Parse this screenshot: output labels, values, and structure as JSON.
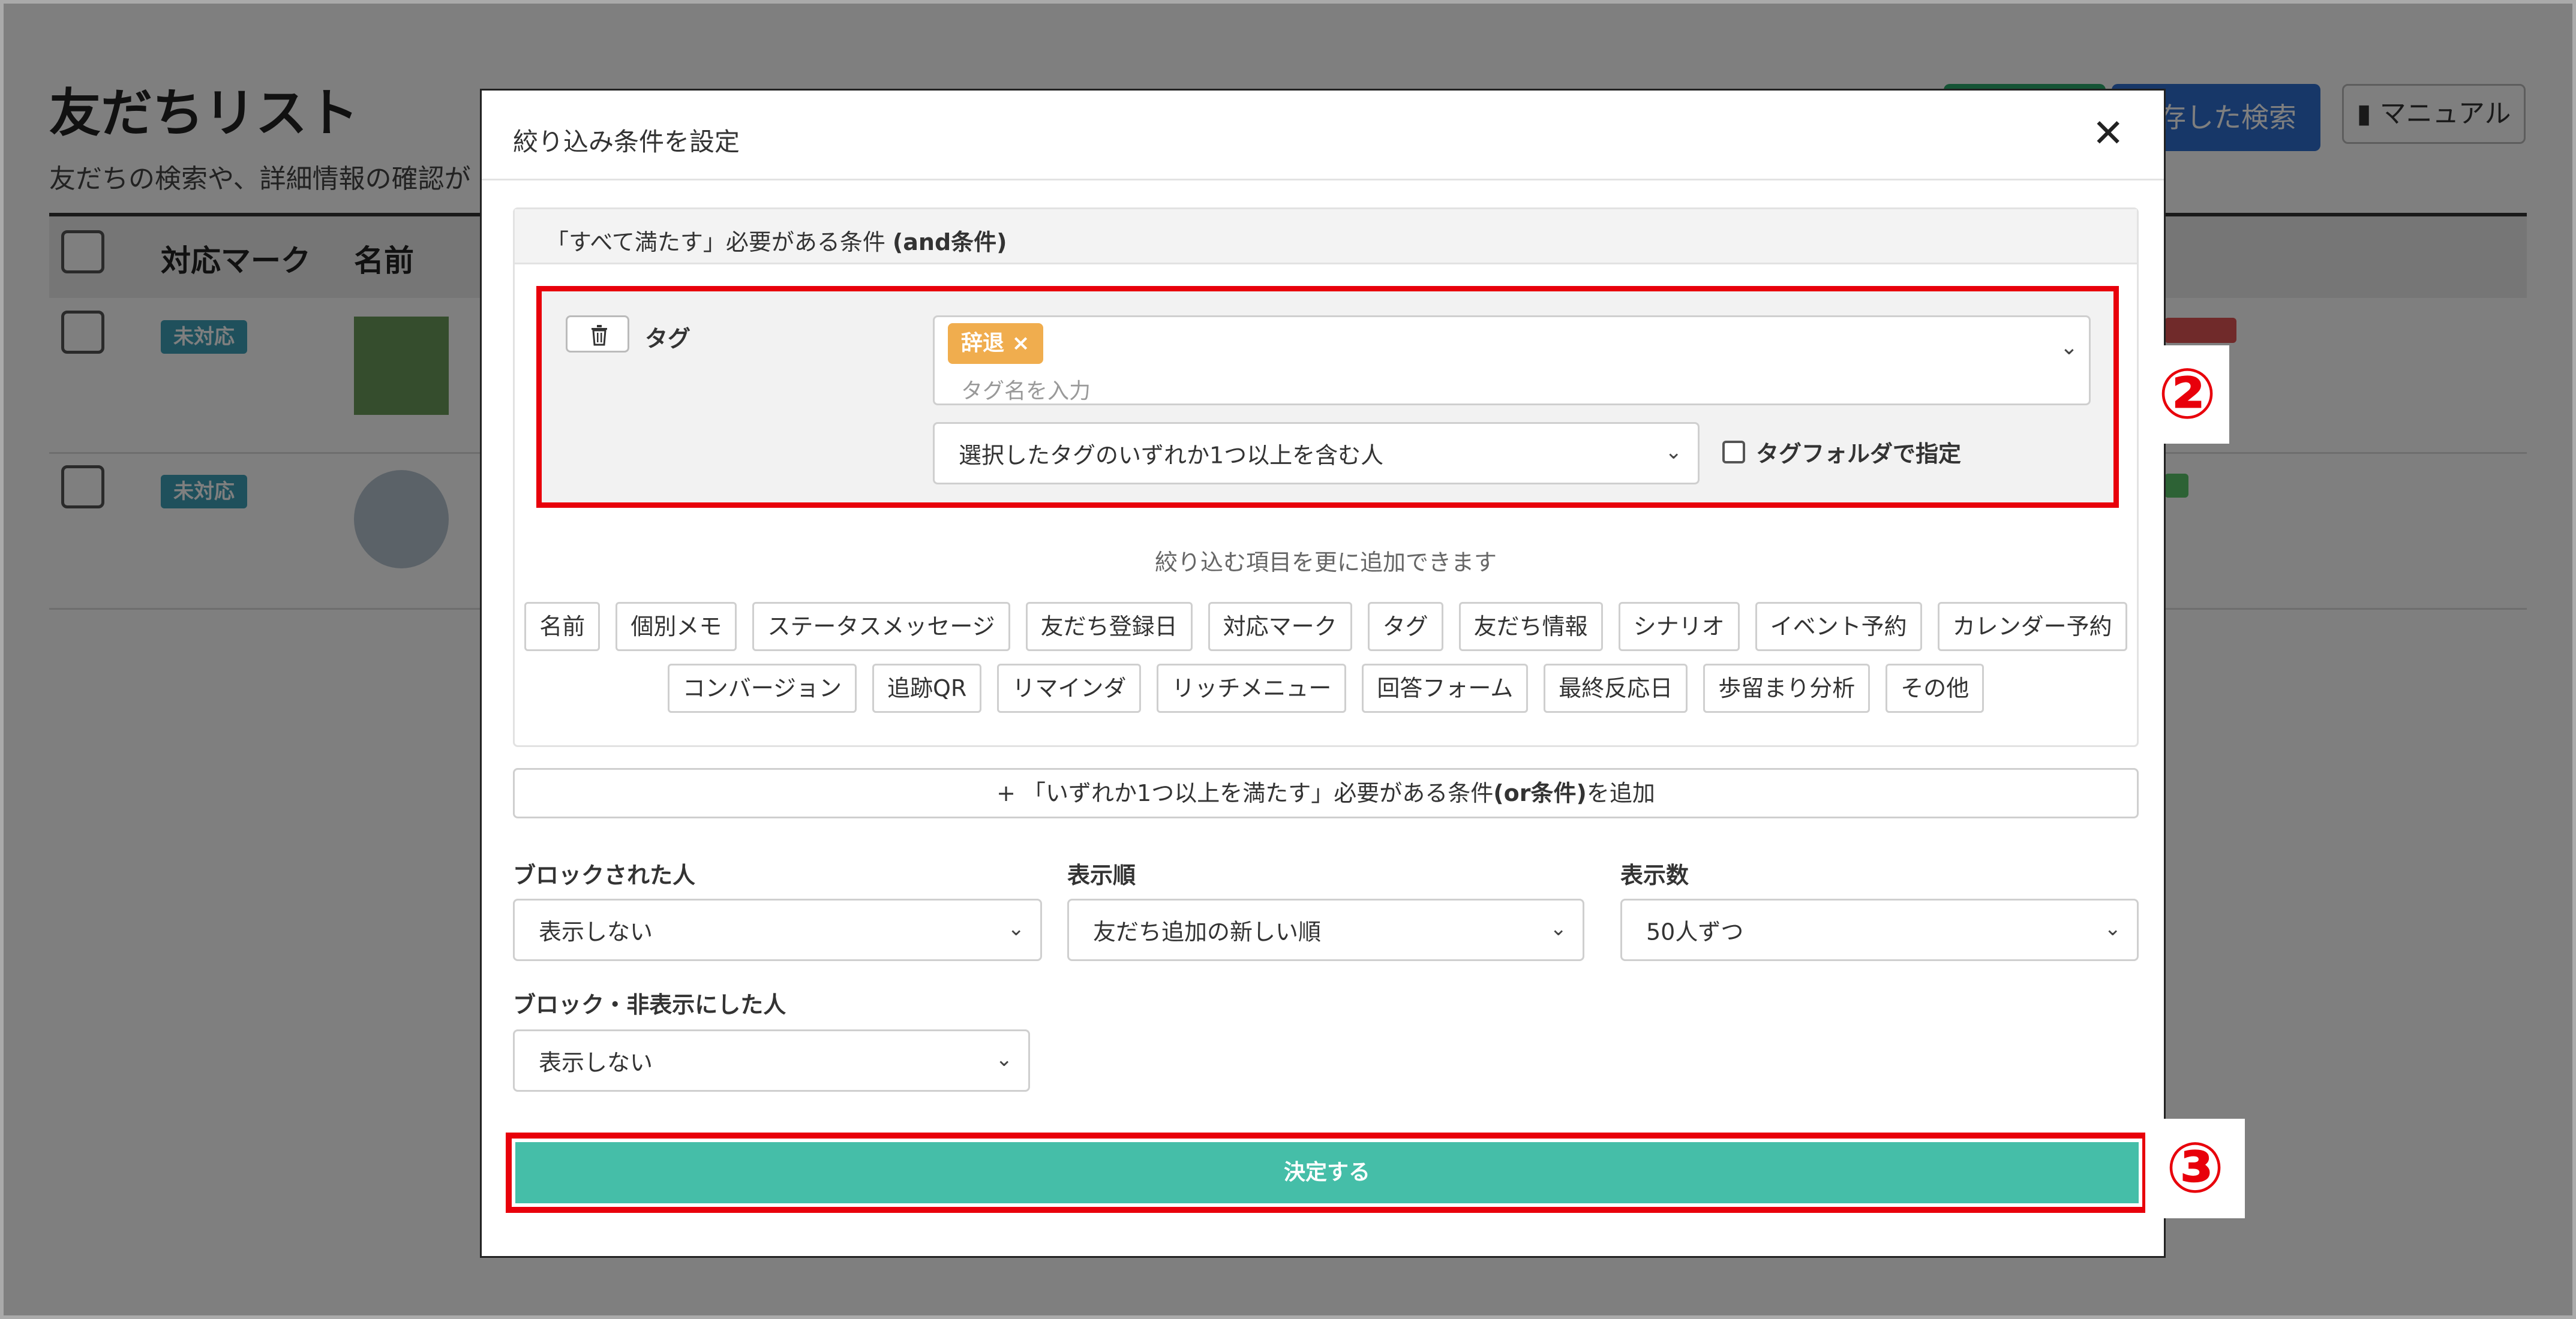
{
  "background": {
    "page_title": "友だちリスト",
    "page_subtitle": "友だちの検索や、詳細情報の確認が",
    "saved_search_label": "存した検索",
    "manual_label": "マニュアル",
    "columns": [
      "対応マーク",
      "名前"
    ],
    "rows": [
      {
        "status": "未対応"
      },
      {
        "status": "未対応"
      }
    ]
  },
  "modal": {
    "title": "絞り込み条件を設定",
    "and_section": {
      "heading_prefix": "「すべて満たす」必要がある条件 ",
      "heading_bold": "(and条件)"
    },
    "tag_condition": {
      "label": "タグ",
      "selected_tags": [
        "辞退 ×"
      ],
      "input_placeholder": "タグ名を入力",
      "match_mode": "選択したタグのいずれか1つ以上を含む人",
      "folder_checkbox_label": "タグフォルダで指定",
      "folder_checked": false
    },
    "add_hint": "絞り込む項目を更に追加できます",
    "add_items_row1": [
      "名前",
      "個別メモ",
      "ステータスメッセージ",
      "友だち登録日",
      "対応マーク",
      "タグ",
      "友だち情報",
      "シナリオ",
      "イベント予約",
      "カレンダー予約"
    ],
    "add_items_row2": [
      "コンバージョン",
      "追跡QR",
      "リマインダ",
      "リッチメニュー",
      "回答フォーム",
      "最終反応日",
      "歩留まり分析",
      "その他"
    ],
    "or_button": {
      "prefix": "+ 「いずれか1つ以上を満たす」必要がある条件",
      "bold": "(or条件)",
      "suffix": "を追加"
    },
    "blocked": {
      "label": "ブロックされた人",
      "value": "表示しない"
    },
    "sort_order": {
      "label": "表示順",
      "value": "友だち追加の新しい順"
    },
    "per_page": {
      "label": "表示数",
      "value": "50人ずつ"
    },
    "hidden": {
      "label": "ブロック・非表示にした人",
      "value": "表示しない"
    },
    "submit_label": "決定する"
  },
  "annotations": {
    "marker_2": "②",
    "marker_3": "③",
    "highlight_color": "#e8000b"
  },
  "colors": {
    "tag_chip": "#f0ad4e",
    "submit": "#45bea8",
    "status_badge": "#3ea0b8"
  }
}
